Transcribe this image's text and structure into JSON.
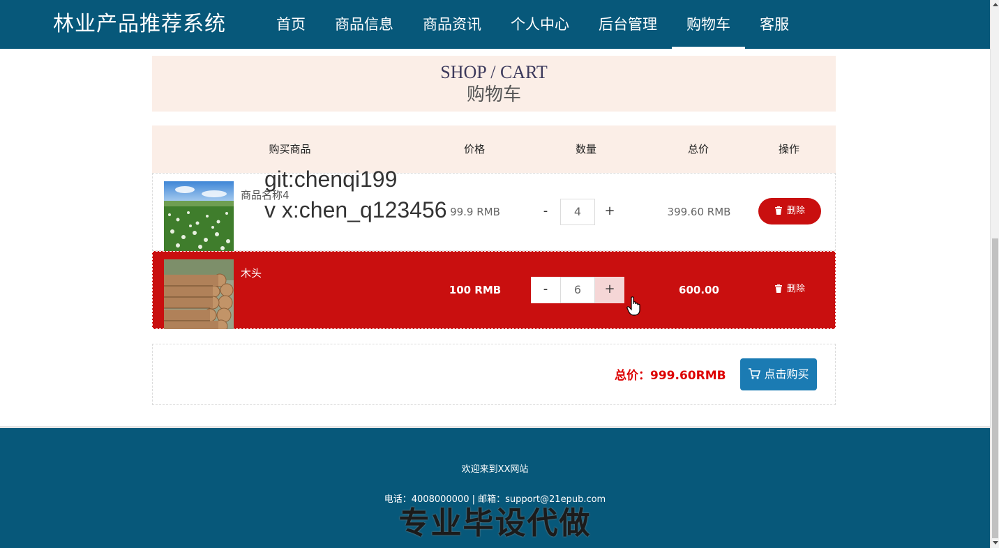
{
  "header": {
    "brand": "林业产品推荐系统",
    "nav": [
      "首页",
      "商品信息",
      "商品资讯",
      "个人中心",
      "后台管理",
      "购物车",
      "客服"
    ],
    "active_nav": "购物车"
  },
  "title": {
    "en": "SHOP / CART",
    "cn": "购物车"
  },
  "table": {
    "headers": {
      "name": "购买商品",
      "price": "价格",
      "qty": "数量",
      "total": "总价",
      "op": "操作"
    },
    "rows": [
      {
        "name": "商品名称4",
        "price": "99.9 RMB",
        "qty": "4",
        "total": "399.60 RMB",
        "delete": "删除",
        "minus": "-",
        "plus": "+"
      },
      {
        "name": "木头",
        "price": "100 RMB",
        "qty": "6",
        "total": "600.00 RMB",
        "delete": "删除",
        "minus": "-",
        "plus": "+"
      }
    ]
  },
  "overlay": {
    "line1": "git:chenqi199",
    "line2": "v x:chen_q123456"
  },
  "summary": {
    "total": "总价：999.60RMB",
    "buy": "点击购买"
  },
  "footer": {
    "welcome": "欢迎来到XX网站",
    "contact": "电话：4008000000 | 邮箱：support@21epub.com",
    "watermark": "专业毕设代做"
  },
  "colors": {
    "header": "#07587a",
    "highlight": "#c90f0f",
    "accent_red": "#d00000",
    "buy_button": "#1b7bb3",
    "title_bg": "#fbeee7"
  }
}
